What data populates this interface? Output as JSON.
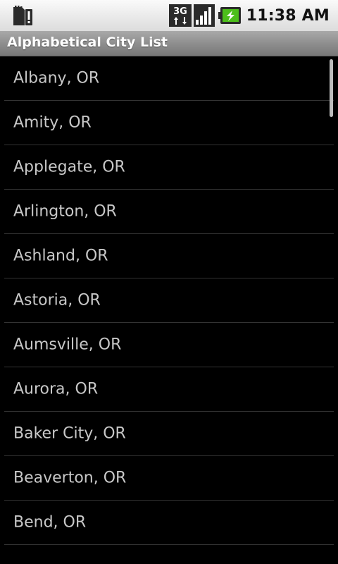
{
  "status_bar": {
    "time": "11:38 AM",
    "network_type": "3G",
    "icons": [
      "sd-card-alert-icon",
      "3g-data-icon",
      "signal-strength-icon",
      "battery-charging-icon"
    ],
    "colors": {
      "battery_fill": "#4cbf1a"
    }
  },
  "title_bar": {
    "title": "Alphabetical City List"
  },
  "city_list": {
    "items": [
      "Albany, OR",
      "Amity, OR",
      "Applegate, OR",
      "Arlington, OR",
      "Ashland, OR",
      "Astoria, OR",
      "Aumsville, OR",
      "Aurora, OR",
      "Baker City, OR",
      "Beaverton, OR",
      "Bend, OR"
    ]
  }
}
